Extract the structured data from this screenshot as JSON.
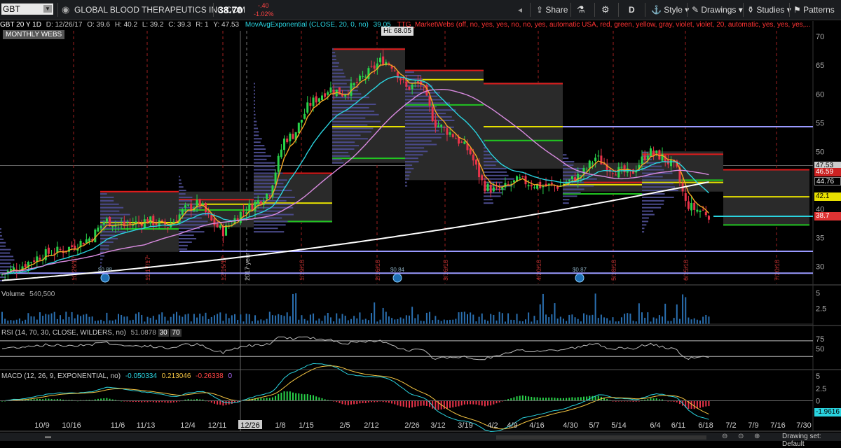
{
  "toolbar": {
    "symbol": "GBT",
    "company": "GLOBAL BLOOD THERAPEUTICS INC COM",
    "last": "38.70",
    "change": "-.40",
    "change_pct": "-1.02%",
    "share": "Share",
    "period": "D",
    "style": "Style",
    "drawings": "Drawings",
    "studies": "Studies",
    "patterns": "Patterns"
  },
  "infobar": {
    "period_label": "GBT 20 Y 1D",
    "d": "D: 12/26/17",
    "o": "O: 39.6",
    "h": "H: 40.2",
    "l": "L: 39.2",
    "c": "C: 39.3",
    "r": "R: 1",
    "y": "Y: 47.53",
    "ma_label": "MovAvgExponential (CLOSE, 20, 0, no)",
    "ma_value": "39.05",
    "study_label": "TTG_MarketWebs (off, no, yes, yes, no, no, yes, automatic USA, red, green, yellow, gray, violet, violet, 20, automatic, yes, yes, yes,..."
  },
  "price_pane": {
    "badge": "MONTHLY WEBS",
    "hi_label": "Hi: 68.05",
    "y_ticks": [
      "70",
      "65",
      "60",
      "55",
      "50",
      "45",
      "40",
      "35",
      "30"
    ],
    "price_tags": [
      {
        "text": "47.53",
        "bg": "#cccccc",
        "fg": "#000000",
        "price": 47.53
      },
      {
        "text": "46.59",
        "bg": "#cc2222",
        "fg": "#ffffff",
        "price": 46.4
      },
      {
        "text": "44.76",
        "bg": "#000000",
        "fg": "#ffffff",
        "price": 44.76
      },
      {
        "text": "42.1",
        "bg": "#e8e000",
        "fg": "#000000",
        "price": 42.1
      },
      {
        "text": "38.7",
        "bg": "#dd3333",
        "fg": "#ffffff",
        "price": 38.7
      }
    ],
    "period_markers": [
      "10/26/17",
      "11/17/17",
      "12/15/17",
      "2017 year",
      "1/19/18",
      "2/16/18",
      "3/16/18",
      "4/20/18",
      "5/18/18",
      "6/15/18",
      "7/20/18"
    ],
    "event_icons": [
      "earnings-icon",
      "earnings-icon",
      "earnings-icon"
    ],
    "event_labels": [
      "$0.88",
      "$0.84",
      "$0.87"
    ]
  },
  "volume_pane": {
    "label": "Volume",
    "value": "540,500",
    "y_ticks": [
      "5",
      "2.5"
    ]
  },
  "rsi_pane": {
    "label": "RSI (14, 70, 30, CLOSE, WILDERS, no)",
    "value": "51.0878",
    "lvl30": "30",
    "lvl70": "70",
    "y_ticks": [
      "75",
      "50"
    ]
  },
  "macd_pane": {
    "label": "MACD (12, 26, 9, EXPONENTIAL, no)",
    "v1": "-0.050334",
    "v2": "0.213046",
    "v3": "-0.26338",
    "v4": "0",
    "y_ticks": [
      "5",
      "2.5",
      "0"
    ],
    "last_tag": "-1.9616"
  },
  "x_axis": {
    "labels": [
      "10/9",
      "10/16",
      "11/6",
      "11/13",
      "12/4",
      "12/11",
      "12/26",
      "1/8",
      "1/15",
      "2/5",
      "2/12",
      "2/26",
      "3/12",
      "3/19",
      "4/2",
      "4/9",
      "4/16",
      "4/30",
      "5/7",
      "5/14",
      "6/4",
      "6/11",
      "6/18",
      "7/2",
      "7/9",
      "7/16",
      "7/30"
    ],
    "selected": "12/26"
  },
  "status": {
    "drawing_set": "Drawing set: Default"
  },
  "colors": {
    "ema_short": "#f5a623",
    "ema_mid": "#2ad4e0",
    "sma_long": "#d98be0",
    "sma_200": "#ffffff",
    "up": "#29d34a",
    "down": "#e8334a",
    "web_red": "#e01b1b",
    "web_green": "#21c521",
    "web_yellow": "#e6e000",
    "web_violet": "#9a9aff"
  }
}
